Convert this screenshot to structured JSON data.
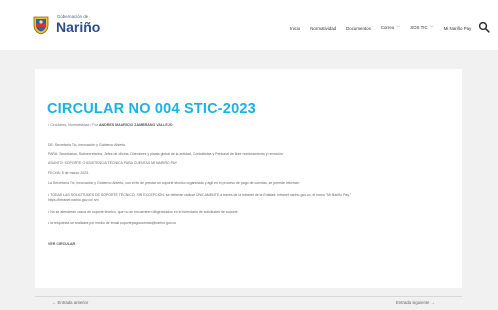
{
  "header": {
    "brand_small": "Gobernación de",
    "brand": "Nariño",
    "nav": [
      {
        "label": "Inicio",
        "has_dropdown": false
      },
      {
        "label": "Normatividad",
        "has_dropdown": false
      },
      {
        "label": "Documentos",
        "has_dropdown": false
      },
      {
        "label": "Correo",
        "has_dropdown": true
      },
      {
        "label": "SOS TIC",
        "has_dropdown": true
      },
      {
        "label": "Mi Nariño Pay",
        "has_dropdown": false
      }
    ]
  },
  "article": {
    "title": "CIRCULAR NO 004 STIC-2023",
    "meta_prefix": "/ Circulares, Normatividad / Por",
    "meta_author": "ANDRES MAURICIO ZAMBRANO VALLEJO",
    "paragraphs": [
      "DE: Secretaría Tic, Innovación y Gobierno Abierto.",
      "PARA: Secretarios, Subsecretarios, Jefes de oficina, Directores y planta global de la entidad, Contratistas y Personal de libre nombramiento y remoción",
      "ASUNTO: SOPORTE O ASISTENCIA TÉCNICA PARA CUENTAS MI NARIÑO PAY",
      "FECHA: 8 de marzo 2023.",
      "La Secretaría Tic, Innovación y Gobierno Abierto, con el fin de prestar un soporte técnico organizado y ágil en el proceso de pago de cuentas, se permite informar:",
      "• TODAS LAS SOLICITUDES DE SOPORTE TÉCNICO, SIN EXCEPCIÓN, se deberán radicar ÚNICAMENTE a través de la intranet de la Entidad: intranet.narino.gov.co, el menú \"Mi Nariño Pay.\"",
      "https://intranet.narino.gov.co/ sm",
      "• No se atenderán casos de soporte técnico, que no se encuentren diligenciados en el formulario de solicitudes de soporte.",
      "• la respuesta se realizara por medio de email soportepagocuentas@narino.gov.co"
    ],
    "read_more": "VER CIRCULAR"
  },
  "pagination": {
    "prev": "← Entrada anterior",
    "next": "Entrada siguiente →"
  },
  "colors": {
    "title": "#19b3e4",
    "brand": "#2f4e84",
    "background": "#f1f1f1"
  }
}
